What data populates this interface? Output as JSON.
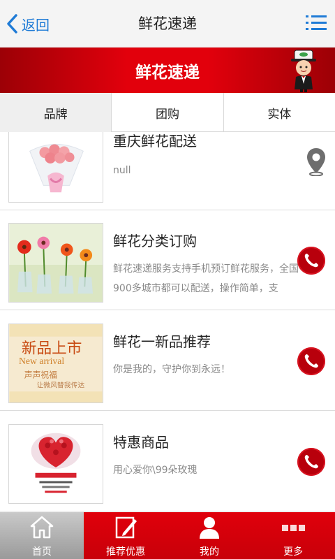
{
  "header": {
    "back_label": "返回",
    "title": "鲜花速递",
    "menu_icon": "list-menu-icon",
    "link_color": "#1f7bd6"
  },
  "banner": {
    "title": "鲜花速递",
    "mascot_icon": "mascot-icon",
    "color": "#e2000c"
  },
  "tabs": [
    {
      "label": "品牌",
      "active": true
    },
    {
      "label": "团购",
      "active": false
    },
    {
      "label": "实体",
      "active": false
    }
  ],
  "items": [
    {
      "title": "重庆鲜花配送",
      "desc": "null",
      "action_icon": "location-pin-icon",
      "thumb": "pink-bouquet"
    },
    {
      "title": "鲜花分类订购",
      "desc": "鲜花速递服务支持手机预订鲜花服务，全国900多城市都可以配送，操作简单，支",
      "action_icon": "phone-icon",
      "thumb": "flowers-in-vases"
    },
    {
      "title": "鲜花一新品推荐",
      "desc": "你是我的，守护你到永远！",
      "action_icon": "phone-icon",
      "thumb": "new-arrival-card",
      "thumb_text": {
        "line1": "新品上市",
        "line2": "New arrival",
        "line3": "声声祝福",
        "line4": "让微风替我传达"
      }
    },
    {
      "title": "特惠商品",
      "desc": "用心爱你\\99朵玫瑰",
      "action_icon": "phone-icon",
      "thumb": "rose-heart-bouquet"
    }
  ],
  "bottom_nav": [
    {
      "label": "首页",
      "icon": "home-icon",
      "active": true
    },
    {
      "label": "推荐优惠",
      "icon": "edit-icon",
      "active": false
    },
    {
      "label": "我的",
      "icon": "user-icon",
      "active": false
    },
    {
      "label": "更多",
      "icon": "more-icon",
      "active": false
    }
  ],
  "colors": {
    "brand_red": "#e2000c",
    "call_red": "#b8000c",
    "pin_gray": "#6e6e6e"
  }
}
